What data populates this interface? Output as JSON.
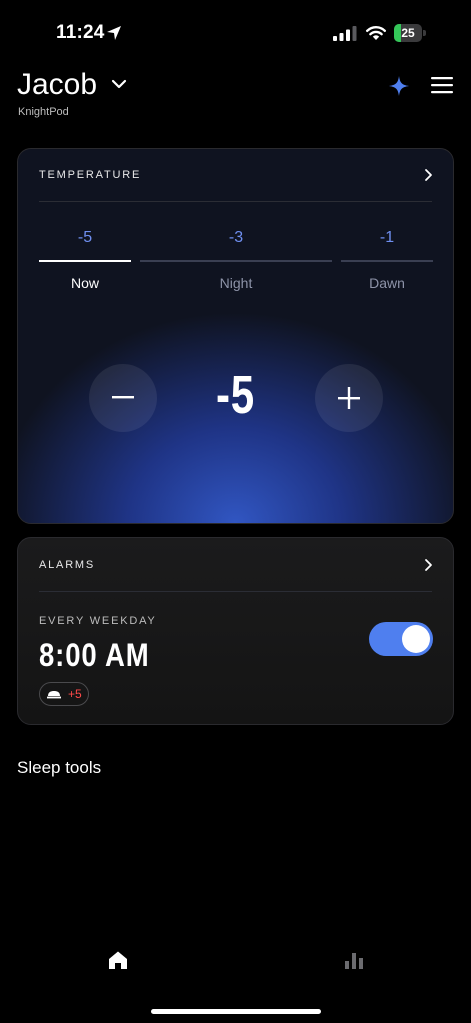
{
  "status_bar": {
    "time": "11:24",
    "battery": "25",
    "battery_level": 0.25
  },
  "header": {
    "user": "Jacob",
    "device": "KnightPod"
  },
  "temperature": {
    "title": "TEMPERATURE",
    "tabs": [
      {
        "value": "-5",
        "label": "Now",
        "active": true
      },
      {
        "value": "-3",
        "label": "Night",
        "active": false
      },
      {
        "value": "-1",
        "label": "Dawn",
        "active": false
      }
    ],
    "current": "-5"
  },
  "alarms": {
    "title": "ALARMS",
    "schedule": "EVERY WEEKDAY",
    "time": "8:00 AM",
    "enabled": true,
    "chip_value": "+5"
  },
  "sections": {
    "sleep_tools": "Sleep tools"
  },
  "colors": {
    "accent": "#4f7fef",
    "temp_value": "#6f8ff0",
    "chip_value": "#ff4a4a",
    "battery": "#34c759"
  },
  "icons": {
    "status": [
      "location-arrow-icon",
      "cellular-signal-icon",
      "wifi-icon",
      "battery-icon"
    ],
    "header": [
      "chevron-down-icon",
      "sparkle-icon",
      "menu-icon"
    ],
    "tab_bar": [
      "home-icon",
      "bar-chart-icon"
    ]
  }
}
